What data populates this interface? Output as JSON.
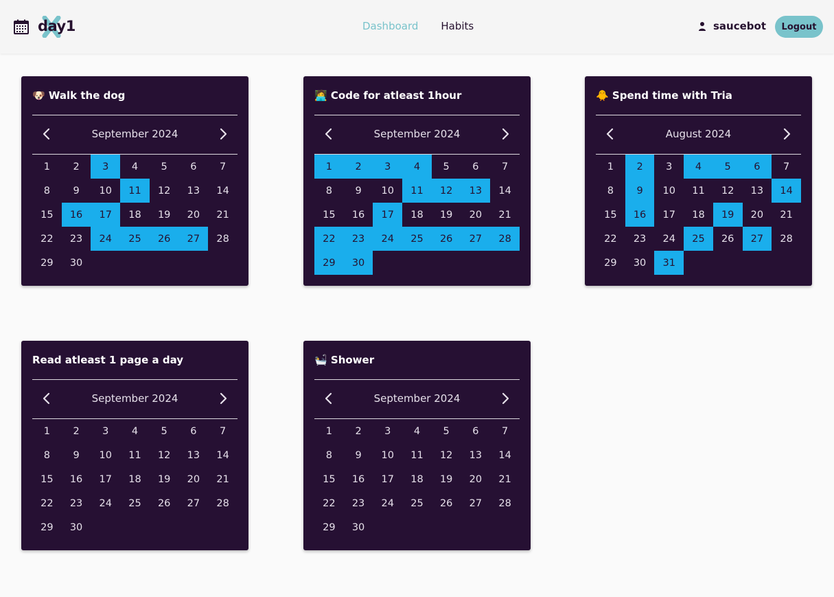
{
  "header": {
    "brand": "day1",
    "nav": [
      {
        "label": "Dashboard",
        "active": true
      },
      {
        "label": "Habits",
        "active": false
      }
    ],
    "username": "saucebot",
    "logout_label": "Logout",
    "colors": {
      "accent": "#79c3cb",
      "card_bg": "#261033",
      "done_bg": "#1aaeec"
    }
  },
  "habits": [
    {
      "title": "🐶 Walk the dog",
      "month_label": "September 2024",
      "days_in_month": 30,
      "start_offset": 0,
      "completed": [
        3,
        11,
        16,
        17,
        24,
        25,
        26,
        27
      ]
    },
    {
      "title": "🧑‍💻 Code for atleast 1hour",
      "month_label": "September 2024",
      "days_in_month": 30,
      "start_offset": 0,
      "completed": [
        1,
        2,
        3,
        4,
        11,
        12,
        13,
        17,
        22,
        23,
        24,
        25,
        26,
        27,
        28,
        29,
        30
      ]
    },
    {
      "title": "🐥 Spend time with Tria",
      "month_label": "August 2024",
      "days_in_month": 31,
      "start_offset": 0,
      "completed": [
        2,
        4,
        5,
        6,
        9,
        14,
        16,
        19,
        25,
        27,
        31
      ]
    },
    {
      "title": "Read atleast 1 page a day",
      "month_label": "September 2024",
      "days_in_month": 30,
      "start_offset": 0,
      "completed": []
    },
    {
      "title": "🛀 Shower",
      "month_label": "September 2024",
      "days_in_month": 30,
      "start_offset": 0,
      "completed": []
    }
  ]
}
